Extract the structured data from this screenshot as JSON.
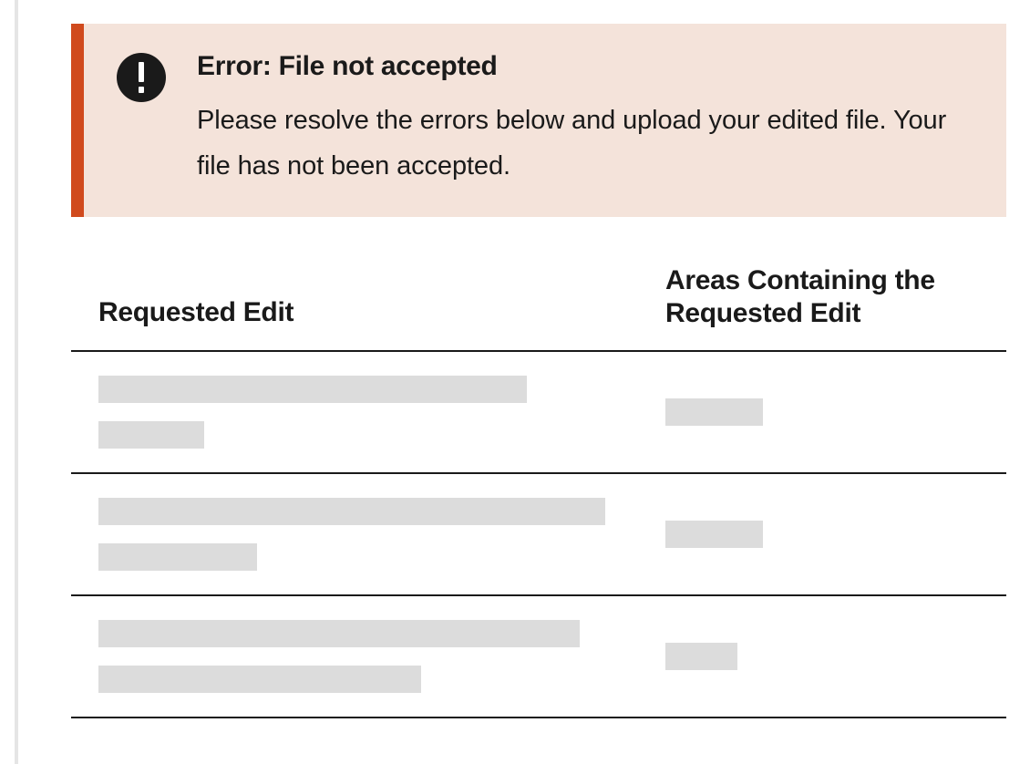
{
  "alert": {
    "title": "Error: File not accepted",
    "message": "Please resolve the errors below and upload your edited file. Your file has not been accepted."
  },
  "table": {
    "headers": {
      "left": "Requested Edit",
      "right": "Areas Containing the Requested Edit"
    },
    "rows": [
      {
        "leftBars": [
          470,
          116
        ],
        "rightBar": 107
      },
      {
        "leftBars": [
          556,
          174
        ],
        "rightBar": 107
      },
      {
        "leftBars": [
          528,
          354
        ],
        "rightBar": 79
      }
    ]
  },
  "colors": {
    "alertBg": "#f4e3da",
    "alertBorder": "#d04a1d",
    "iconBg": "#1a1a1a",
    "placeholder": "#dcdcdc",
    "leftRail": "#e5e5e5"
  }
}
